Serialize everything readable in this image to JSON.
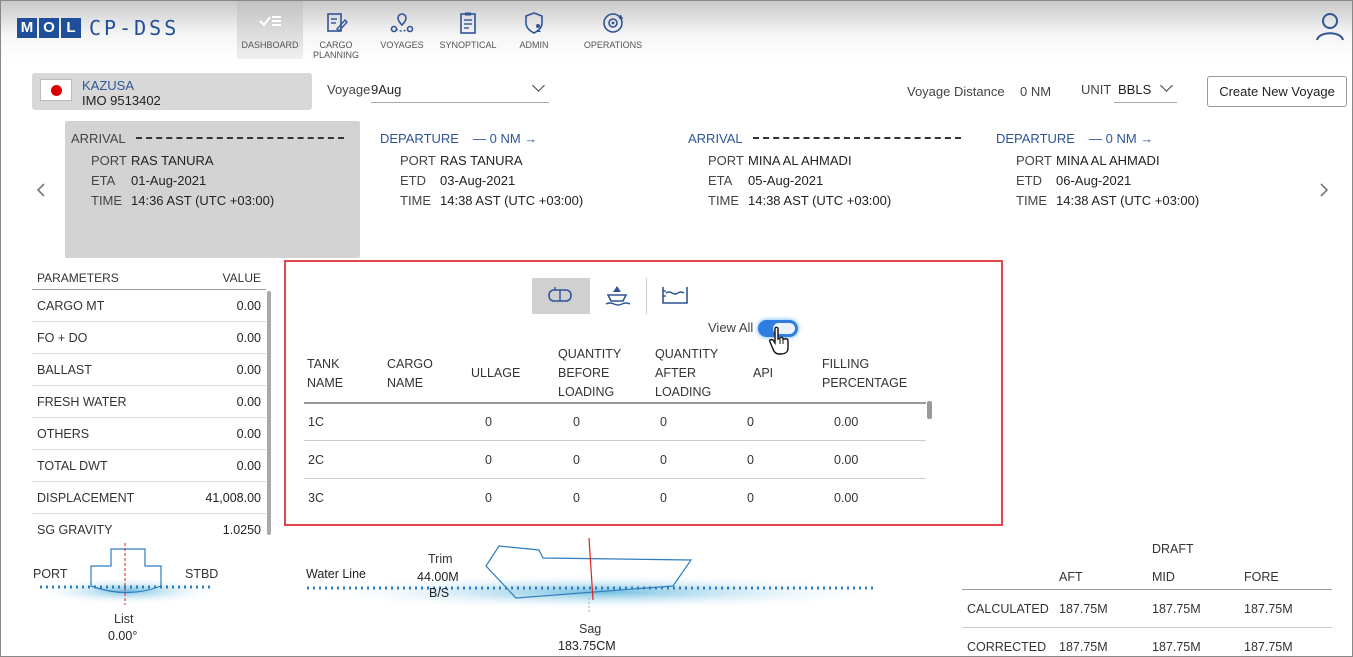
{
  "app": {
    "logo_letters": [
      "M",
      "O",
      "L"
    ],
    "title": "CP-DSS"
  },
  "nav": [
    {
      "label": "DASHBOARD",
      "icon": "checklist-icon",
      "active": true
    },
    {
      "label": "CARGO PLANNING",
      "icon": "edit-document-icon",
      "active": false
    },
    {
      "label": "VOYAGES",
      "icon": "route-icon",
      "active": false
    },
    {
      "label": "SYNOPTICAL",
      "icon": "clipboard-icon",
      "active": false
    },
    {
      "label": "ADMIN",
      "icon": "shield-user-icon",
      "active": false
    },
    {
      "label": "OPERATIONS",
      "icon": "gear-cycle-icon",
      "active": false
    }
  ],
  "vessel": {
    "name": "KAZUSA",
    "imo": "IMO 9513402",
    "flag": "japan-flag-icon"
  },
  "voyage": {
    "label": "Voyage",
    "value": "9Aug"
  },
  "voyage_distance": {
    "label": "Voyage Distance",
    "value": "0 NM"
  },
  "unit": {
    "label": "UNIT",
    "value": "BBLS"
  },
  "create_button": "Create New Voyage",
  "ports": [
    {
      "type": "ARRIVAL",
      "distance": "",
      "port_label": "PORT",
      "port": "RAS TANURA",
      "date_label": "ETA",
      "date": "01-Aug-2021",
      "time_label": "TIME",
      "time": "14:36 AST (UTC +03:00)",
      "active": true
    },
    {
      "type": "DEPARTURE",
      "distance": "0 NM",
      "port_label": "PORT",
      "port": "RAS TANURA",
      "date_label": "ETD",
      "date": "03-Aug-2021",
      "time_label": "TIME",
      "time": "14:38 AST (UTC +03:00)",
      "active": false
    },
    {
      "type": "ARRIVAL",
      "distance": "",
      "port_label": "PORT",
      "port": "MINA AL AHMADI",
      "date_label": "ETA",
      "date": "05-Aug-2021",
      "time_label": "TIME",
      "time": "14:38 AST (UTC +03:00)",
      "active": false
    },
    {
      "type": "DEPARTURE",
      "distance": "0 NM",
      "port_label": "PORT",
      "port": "MINA AL AHMADI",
      "date_label": "ETD",
      "date": "06-Aug-2021",
      "time_label": "TIME",
      "time": "14:38 AST (UTC +03:00)",
      "active": false
    }
  ],
  "parameters": {
    "header": {
      "name": "PARAMETERS",
      "value": "VALUE"
    },
    "rows": [
      {
        "name": "CARGO MT",
        "value": "0.00"
      },
      {
        "name": "FO + DO",
        "value": "0.00"
      },
      {
        "name": "BALLAST",
        "value": "0.00"
      },
      {
        "name": "FRESH WATER",
        "value": "0.00"
      },
      {
        "name": "OTHERS",
        "value": "0.00"
      },
      {
        "name": "TOTAL DWT",
        "value": "0.00"
      },
      {
        "name": "DISPLACEMENT",
        "value": "41,008.00"
      },
      {
        "name": "SG GRAVITY",
        "value": "1.0250"
      }
    ]
  },
  "tank_panel": {
    "view_all": "View All",
    "view_all_on": true,
    "columns": [
      [
        "TANK",
        "NAME"
      ],
      [
        "CARGO",
        "NAME"
      ],
      [
        "ULLAGE"
      ],
      [
        "QUANTITY",
        "BEFORE",
        "LOADING"
      ],
      [
        "QUANTITY",
        "AFTER",
        "LOADING"
      ],
      [
        "API"
      ],
      [
        "FILLING",
        "PERCENTAGE"
      ]
    ],
    "rows": [
      [
        "1C",
        "",
        "0",
        "0",
        "0",
        "0",
        "0.00"
      ],
      [
        "2C",
        "",
        "0",
        "0",
        "0",
        "0",
        "0.00"
      ],
      [
        "3C",
        "",
        "0",
        "0",
        "0",
        "0",
        "0.00"
      ]
    ]
  },
  "stability": {
    "port": "PORT",
    "stbd": "STBD",
    "list_label": "List",
    "list_value": "0.00°",
    "water_line": "Water Line",
    "trim_label": "Trim",
    "trim_value": "44.00M",
    "trim_dir": "B/S",
    "sag_label": "Sag",
    "sag_value": "183.75CM"
  },
  "draft": {
    "title": "DRAFT",
    "columns": [
      "AFT",
      "MID",
      "FORE"
    ],
    "rows": [
      {
        "label": "CALCULATED",
        "values": [
          "187.75M",
          "187.75M",
          "187.75M"
        ]
      },
      {
        "label": "CORRECTED",
        "values": [
          "187.75M",
          "187.75M",
          "187.75M"
        ]
      }
    ]
  }
}
